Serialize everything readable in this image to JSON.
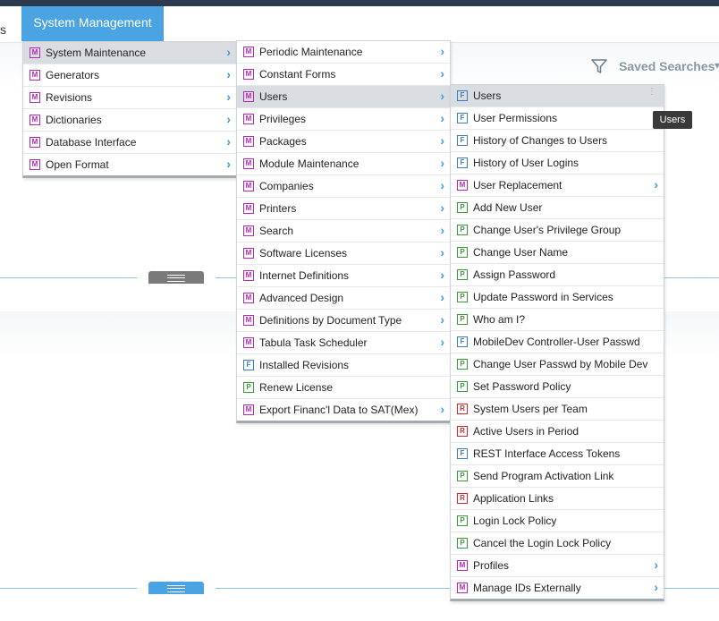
{
  "nav": {
    "prev_label": "s",
    "active_label": "System Management"
  },
  "toolbar": {
    "saved_searches": "Saved Searches",
    "filter_icon": "filter-icon"
  },
  "colors": {
    "accent": "#4aa3e2",
    "badge_M": "#b327b3",
    "badge_F": "#3b7bbf",
    "badge_P": "#3a9a3a",
    "badge_R": "#d02b2b"
  },
  "menu1": [
    {
      "type": "M",
      "label": "System Maintenance",
      "submenu": true,
      "highlight": true
    },
    {
      "type": "M",
      "label": "Generators",
      "submenu": true
    },
    {
      "type": "M",
      "label": "Revisions",
      "submenu": true
    },
    {
      "type": "M",
      "label": "Dictionaries",
      "submenu": true
    },
    {
      "type": "M",
      "label": "Database Interface",
      "submenu": true
    },
    {
      "type": "M",
      "label": "Open Format",
      "submenu": true
    }
  ],
  "menu2": [
    {
      "type": "M",
      "label": "Periodic Maintenance",
      "submenu": true
    },
    {
      "type": "M",
      "label": "Constant Forms",
      "submenu": true
    },
    {
      "type": "M",
      "label": "Users",
      "submenu": true,
      "highlight": true
    },
    {
      "type": "M",
      "label": "Privileges",
      "submenu": true
    },
    {
      "type": "M",
      "label": "Packages",
      "submenu": true
    },
    {
      "type": "M",
      "label": "Module Maintenance",
      "submenu": true
    },
    {
      "type": "M",
      "label": "Companies",
      "submenu": true
    },
    {
      "type": "M",
      "label": "Printers",
      "submenu": true
    },
    {
      "type": "M",
      "label": "Search",
      "submenu": true
    },
    {
      "type": "M",
      "label": "Software Licenses",
      "submenu": true
    },
    {
      "type": "M",
      "label": "Internet Definitions",
      "submenu": true
    },
    {
      "type": "M",
      "label": "Advanced Design",
      "submenu": true
    },
    {
      "type": "M",
      "label": "Definitions by Document Type",
      "submenu": true
    },
    {
      "type": "M",
      "label": "Tabula Task Scheduler",
      "submenu": true
    },
    {
      "type": "F",
      "label": "Installed Revisions"
    },
    {
      "type": "P",
      "label": "Renew License"
    },
    {
      "type": "M",
      "label": "Export Financ'l Data to SAT(Mex)",
      "submenu": true
    }
  ],
  "menu3": [
    {
      "type": "F",
      "label": "Users",
      "highlight": true,
      "more": true
    },
    {
      "type": "F",
      "label": "User Permissions"
    },
    {
      "type": "F",
      "label": "History of Changes to Users"
    },
    {
      "type": "F",
      "label": "History of User Logins"
    },
    {
      "type": "M",
      "label": "User Replacement",
      "submenu": true
    },
    {
      "type": "P",
      "label": "Add New User"
    },
    {
      "type": "P",
      "label": "Change User's Privilege Group"
    },
    {
      "type": "P",
      "label": "Change User Name"
    },
    {
      "type": "P",
      "label": "Assign Password"
    },
    {
      "type": "P",
      "label": "Update Password in Services"
    },
    {
      "type": "P",
      "label": "Who am I?"
    },
    {
      "type": "F",
      "label": "MobileDev Controller-User Passwd"
    },
    {
      "type": "P",
      "label": "Change User Passwd by Mobile Dev"
    },
    {
      "type": "P",
      "label": "Set Password Policy"
    },
    {
      "type": "R",
      "label": "System Users per Team"
    },
    {
      "type": "R",
      "label": "Active Users in Period"
    },
    {
      "type": "F",
      "label": "REST Interface Access Tokens"
    },
    {
      "type": "P",
      "label": "Send Program Activation Link"
    },
    {
      "type": "R",
      "label": "Application Links"
    },
    {
      "type": "P",
      "label": "Login Lock Policy"
    },
    {
      "type": "P",
      "label": "Cancel the Login Lock Policy"
    },
    {
      "type": "M",
      "label": "Profiles",
      "submenu": true
    },
    {
      "type": "M",
      "label": "Manage IDs Externally",
      "submenu": true
    }
  ],
  "tooltip": {
    "text": "Users"
  }
}
